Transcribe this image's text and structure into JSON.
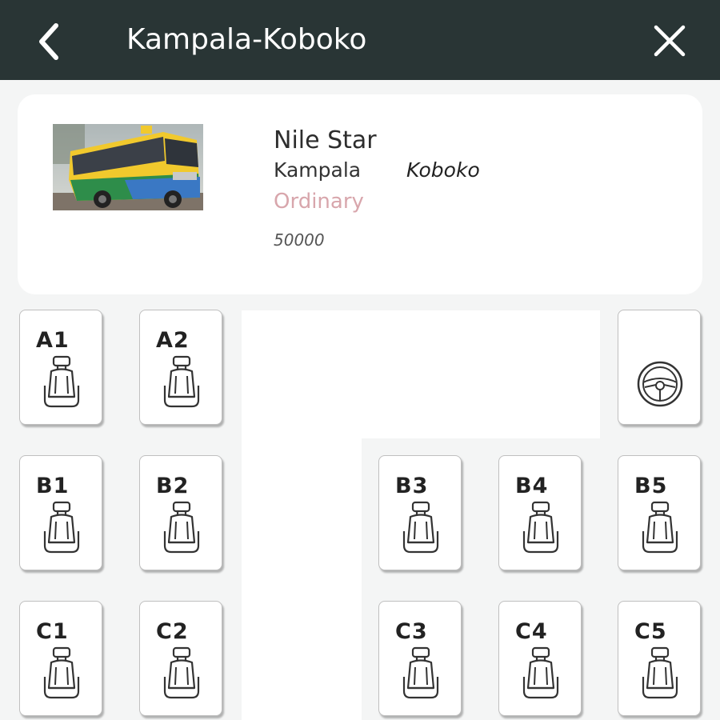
{
  "header": {
    "title": "Kampala-Koboko",
    "back_icon": "chevron-left-icon",
    "close_icon": "close-icon",
    "background": "#293535"
  },
  "bus": {
    "operator": "Nile Star",
    "origin": "Kampala",
    "destination": "Koboko",
    "class": "Ordinary",
    "price": "50000",
    "class_color": "#d8a6ac"
  },
  "driver_icon": "steering-wheel-icon",
  "seat_icon": "car-seat-icon",
  "seats": {
    "A1": "A1",
    "A2": "A2",
    "B1": "B1",
    "B2": "B2",
    "B3": "B3",
    "B4": "B4",
    "B5": "B5",
    "C1": "C1",
    "C2": "C2",
    "C3": "C3",
    "C4": "C4",
    "C5": "C5"
  }
}
